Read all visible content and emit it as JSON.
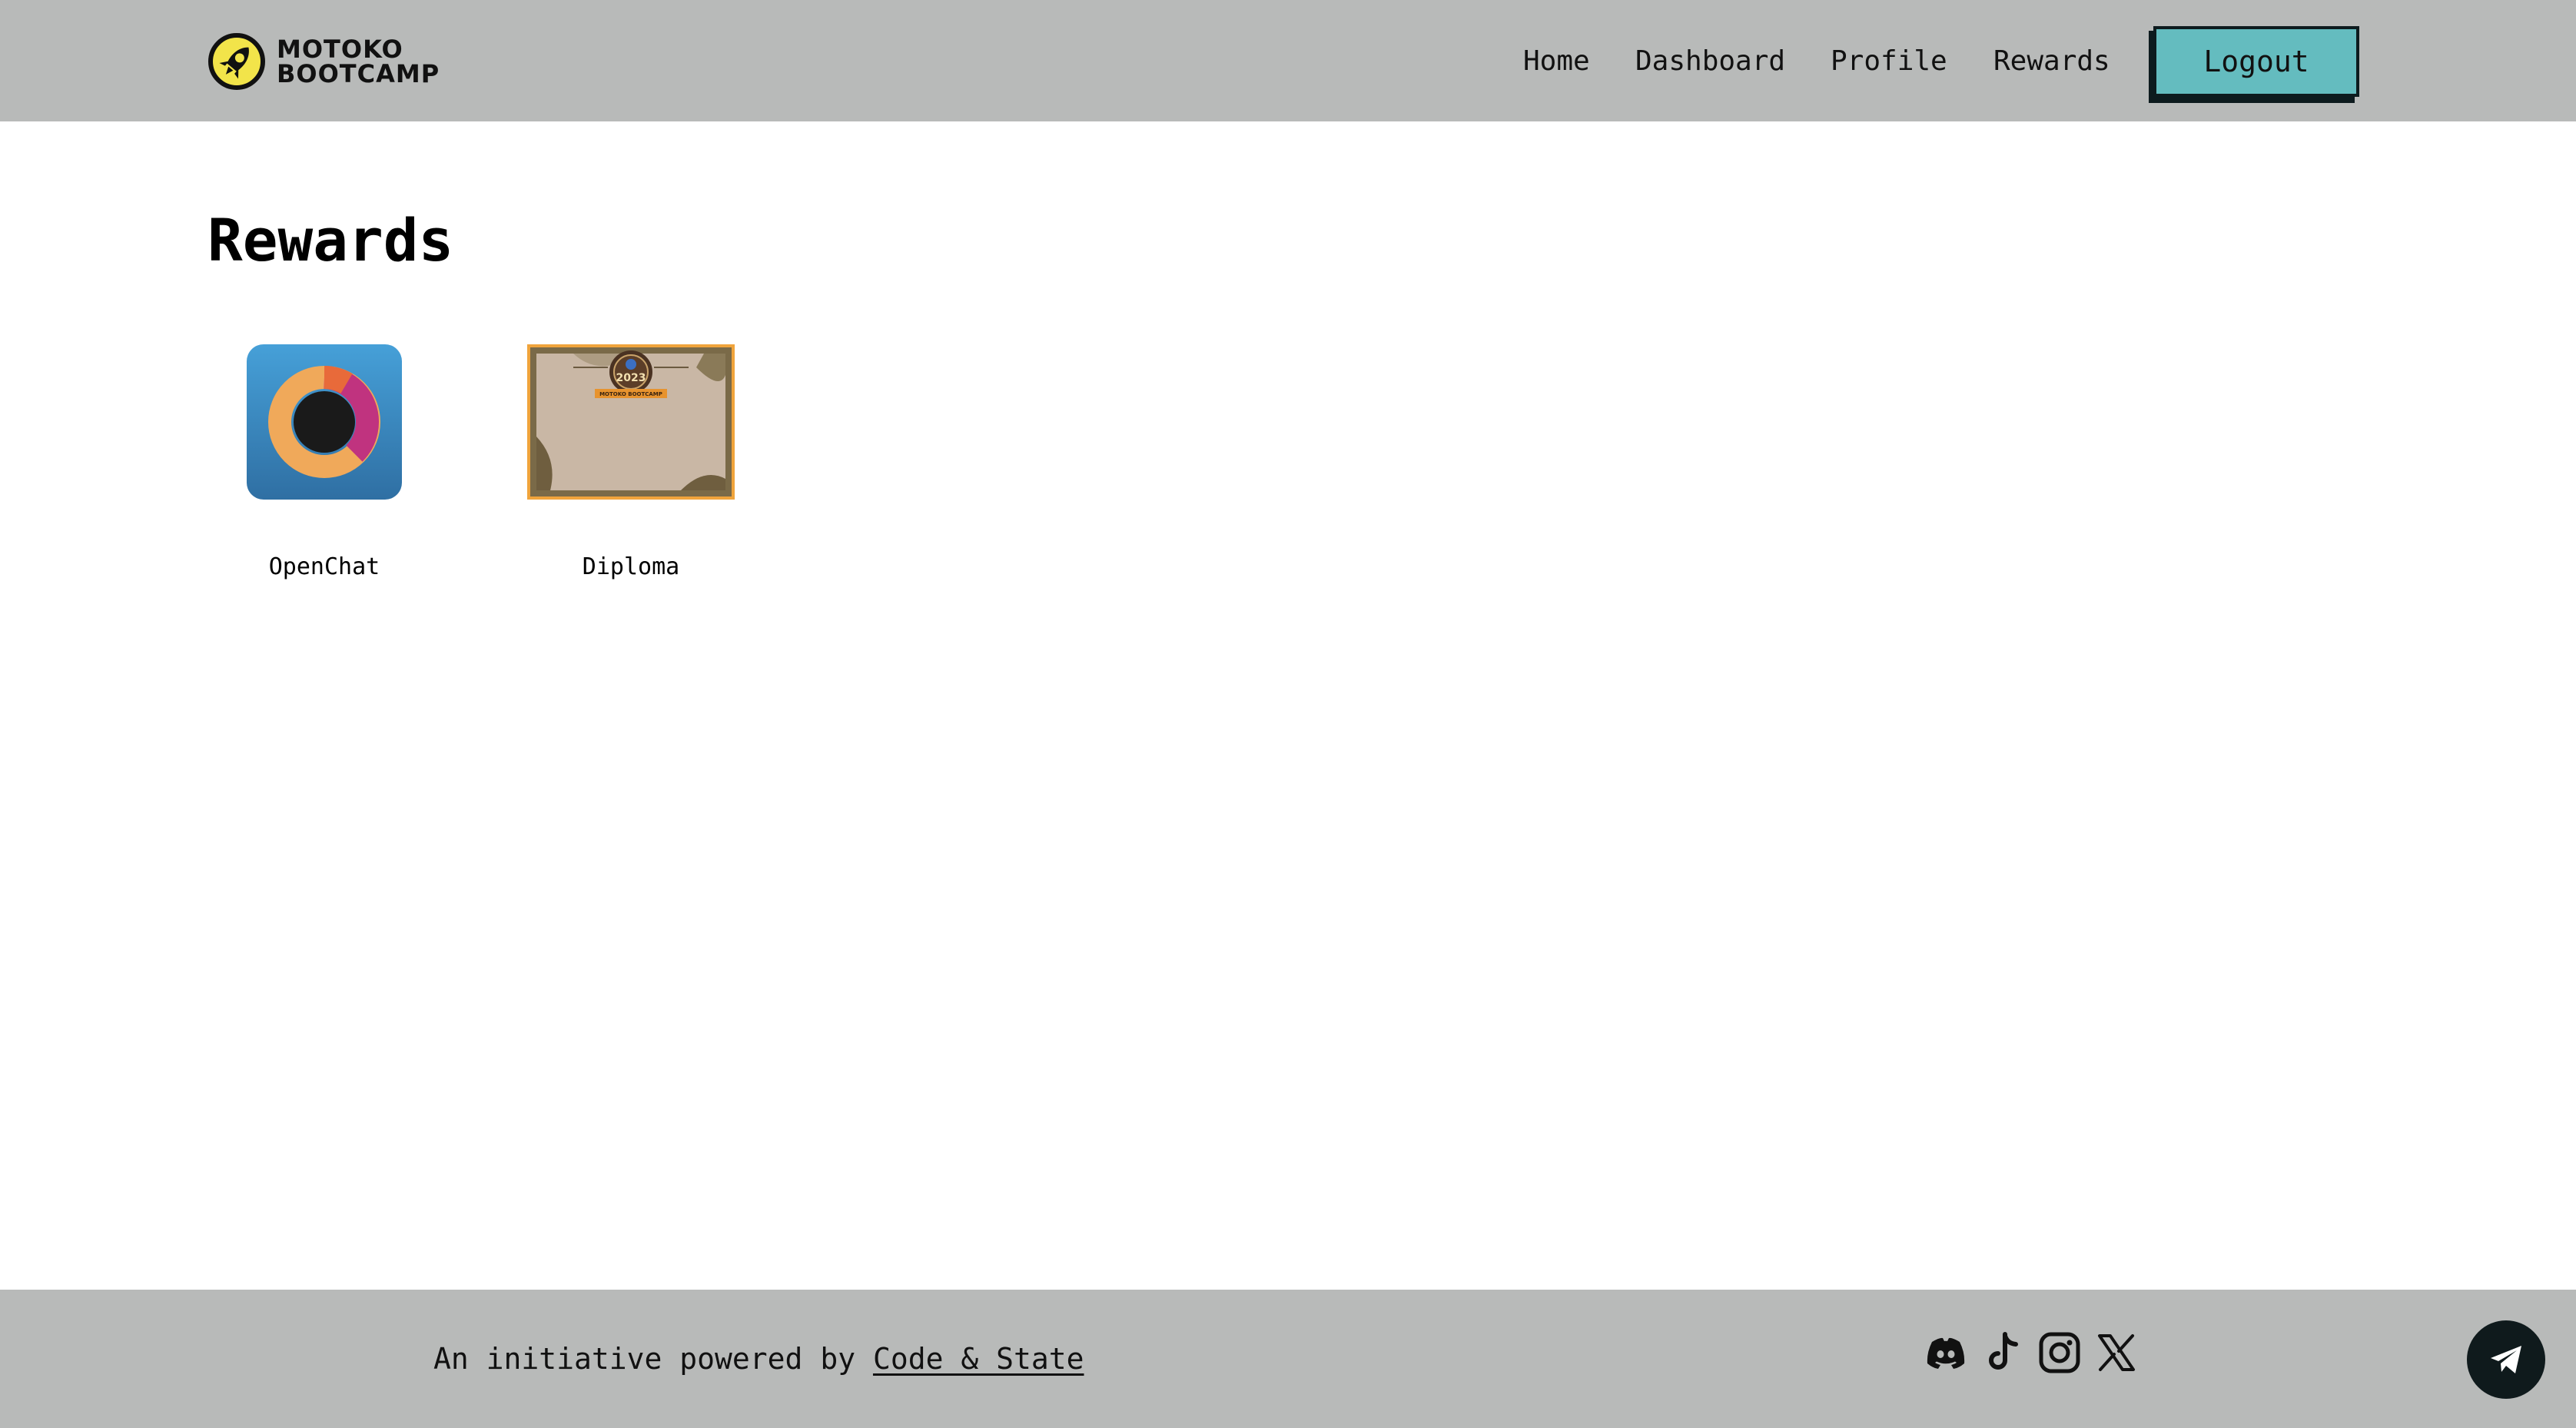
{
  "header": {
    "logo": {
      "line1": "MOTOKO",
      "line2": "BOOTCAMP",
      "icon": "rocket-logo-icon"
    },
    "nav": [
      {
        "label": "Home"
      },
      {
        "label": "Dashboard"
      },
      {
        "label": "Profile"
      },
      {
        "label": "Rewards"
      }
    ],
    "logout_label": "Logout"
  },
  "main": {
    "title": "Rewards",
    "rewards": [
      {
        "label": "OpenChat",
        "icon": "openchat-icon"
      },
      {
        "label": "Diploma",
        "icon": "diploma-certificate-image",
        "badge_text": "2023",
        "banner_text": "MOTOKO BOOTCAMP"
      }
    ]
  },
  "footer": {
    "credit_prefix": "An initiative powered by ",
    "credit_link": "Code & State",
    "socials": [
      {
        "icon": "discord-icon"
      },
      {
        "icon": "tiktok-icon"
      },
      {
        "icon": "instagram-icon"
      },
      {
        "icon": "x-icon"
      }
    ],
    "fab_icon": "telegram-icon"
  },
  "colors": {
    "header_bg": "#b8bab9",
    "footer_bg": "#b8bab9",
    "logout_bg": "#64bcbf",
    "logo_yellow": "#f2e44a",
    "openchat_bg": "#3f8cc6",
    "diploma_border": "#f0a43c"
  }
}
